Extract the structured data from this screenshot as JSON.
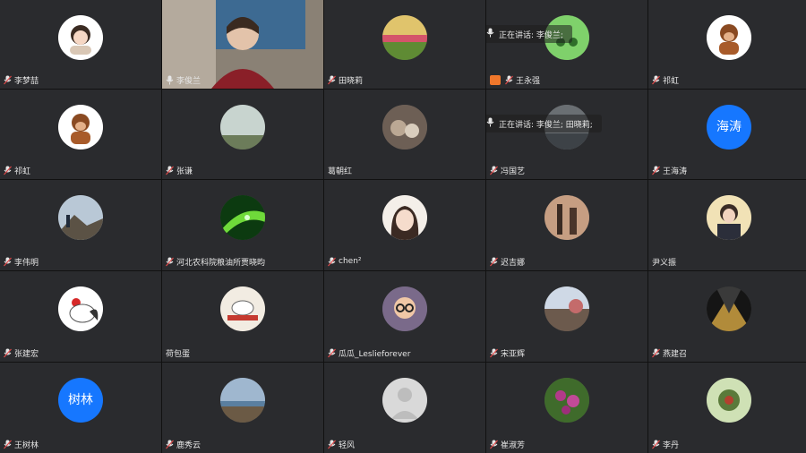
{
  "speaking_prefix_1": "正在讲话: 李俊兰;",
  "speaking_prefix_2": "正在讲话: 李俊兰; 田晓莉;",
  "participants": [
    {
      "name": "李梦喆",
      "avatar": "cartoon-girl-avatar",
      "mic": "muted"
    },
    {
      "name": "李俊兰",
      "avatar": "video-feed",
      "mic": "on"
    },
    {
      "name": "田晓莉",
      "avatar": "landscape-field-avatar",
      "mic": "muted"
    },
    {
      "name": "王永强",
      "avatar": "green-cartoon-avatar",
      "mic": "muted",
      "sharing": true
    },
    {
      "name": "祁虹",
      "avatar": "monkey-avatar",
      "mic": "muted"
    },
    {
      "name": "祁虹",
      "avatar": "monkey-avatar",
      "mic": "muted"
    },
    {
      "name": "张谦",
      "avatar": "sky-landscape-avatar",
      "mic": "muted"
    },
    {
      "name": "葛朝红",
      "avatar": "plush-toys-avatar",
      "mic": "none"
    },
    {
      "name": "冯国艺",
      "avatar": "gray-landscape-avatar",
      "mic": "muted"
    },
    {
      "name": "王海涛",
      "avatar": "text-avatar",
      "avatar_text": "海涛",
      "mic": "muted"
    },
    {
      "name": "李伟明",
      "avatar": "mountain-person-avatar",
      "mic": "muted"
    },
    {
      "name": "河北农科院粮油所贾晓昀",
      "avatar": "green-leaf-avatar",
      "mic": "muted"
    },
    {
      "name": "chen²",
      "avatar": "illustrated-girl-avatar",
      "mic": "muted"
    },
    {
      "name": "迟吉娜",
      "avatar": "shadow-wall-avatar",
      "mic": "muted"
    },
    {
      "name": "尹义振",
      "avatar": "anime-boy-avatar",
      "mic": "none"
    },
    {
      "name": "张建宏",
      "avatar": "rooster-avatar",
      "mic": "muted"
    },
    {
      "name": "荷包蛋",
      "avatar": "sketch-drawing-avatar",
      "mic": "none"
    },
    {
      "name": "瓜瓜_Leslieforever",
      "avatar": "cartoon-glasses-avatar",
      "mic": "muted"
    },
    {
      "name": "宋亚辉",
      "avatar": "street-photo-avatar",
      "mic": "muted"
    },
    {
      "name": "燕建召",
      "avatar": "dark-abstract-avatar",
      "mic": "muted"
    },
    {
      "name": "王树林",
      "avatar": "text-avatar",
      "avatar_text": "树林",
      "mic": "muted"
    },
    {
      "name": "鹿秀云",
      "avatar": "beach-avatar",
      "mic": "muted"
    },
    {
      "name": "轻风",
      "avatar": "default-user-avatar",
      "mic": "muted"
    },
    {
      "name": "崔淑芳",
      "avatar": "purple-flowers-avatar",
      "mic": "muted"
    },
    {
      "name": "李丹",
      "avatar": "flower-avatar",
      "mic": "muted"
    }
  ],
  "colors": {
    "tile_bg": "#2a2b2e",
    "text_avatar_bg": "#1677ff",
    "active_border": "#7ddc63",
    "share_icon": "#f0772b"
  }
}
